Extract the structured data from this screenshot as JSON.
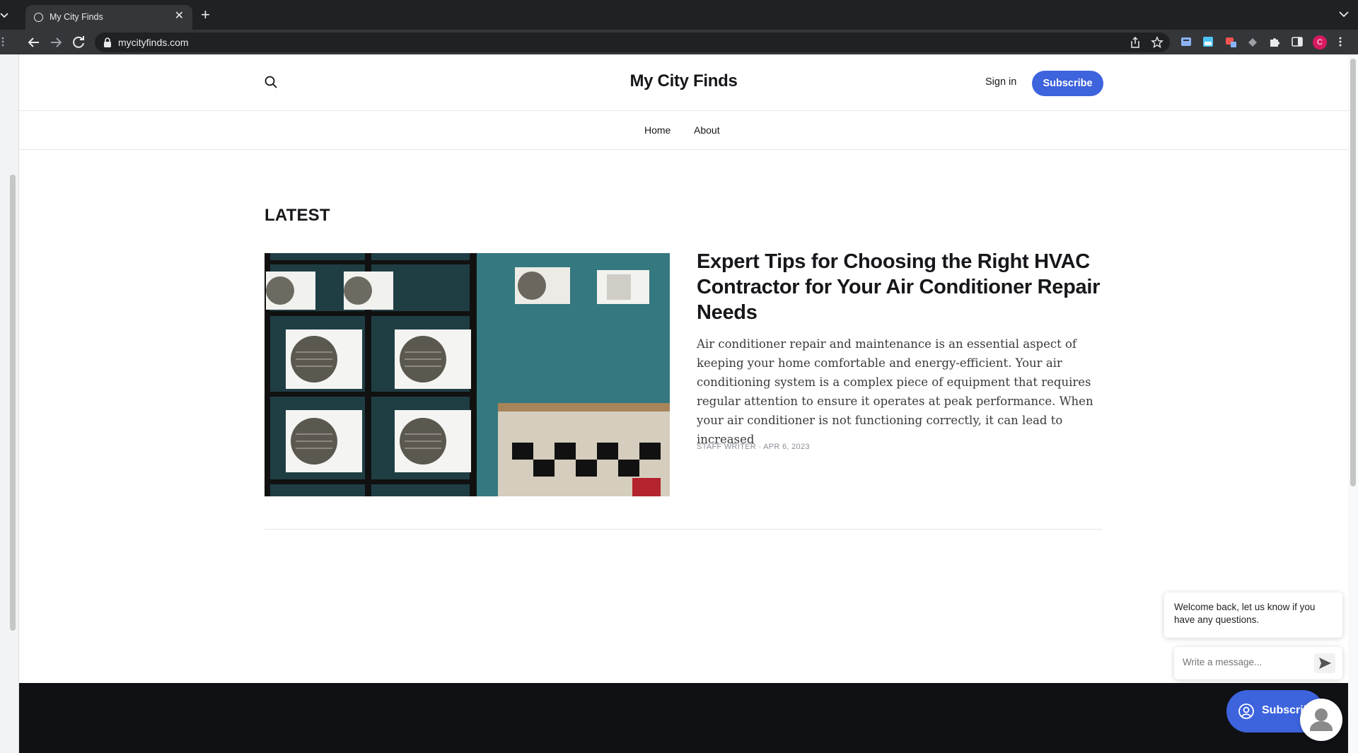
{
  "browser": {
    "tab_title": "My City Finds",
    "url": "mycityfinds.com",
    "profile_initial": "C"
  },
  "site": {
    "title": "My City Finds",
    "signin_label": "Sign in",
    "subscribe_label": "Subscribe",
    "nav": [
      "Home",
      "About"
    ],
    "accent_color": "#3d63dd"
  },
  "latest": {
    "heading": "LATEST",
    "post": {
      "title": "Expert Tips for Choosing the Right HVAC Contractor for Your Air Conditioner Repair Needs",
      "excerpt": "Air conditioner repair and maintenance is an essential aspect of keeping your home comfortable and energy-efficient. Your air conditioning system is a complex piece of equipment that requires regular attention to ensure it operates at peak performance. When your air conditioner is not functioning correctly, it can lead to increased",
      "author": "STAFF WRITER",
      "date": "APR 6, 2023"
    }
  },
  "chat": {
    "welcome": "Welcome back, let us know if you have any questions.",
    "input_placeholder": "Write a message...",
    "portal_label": "Subscribe"
  }
}
